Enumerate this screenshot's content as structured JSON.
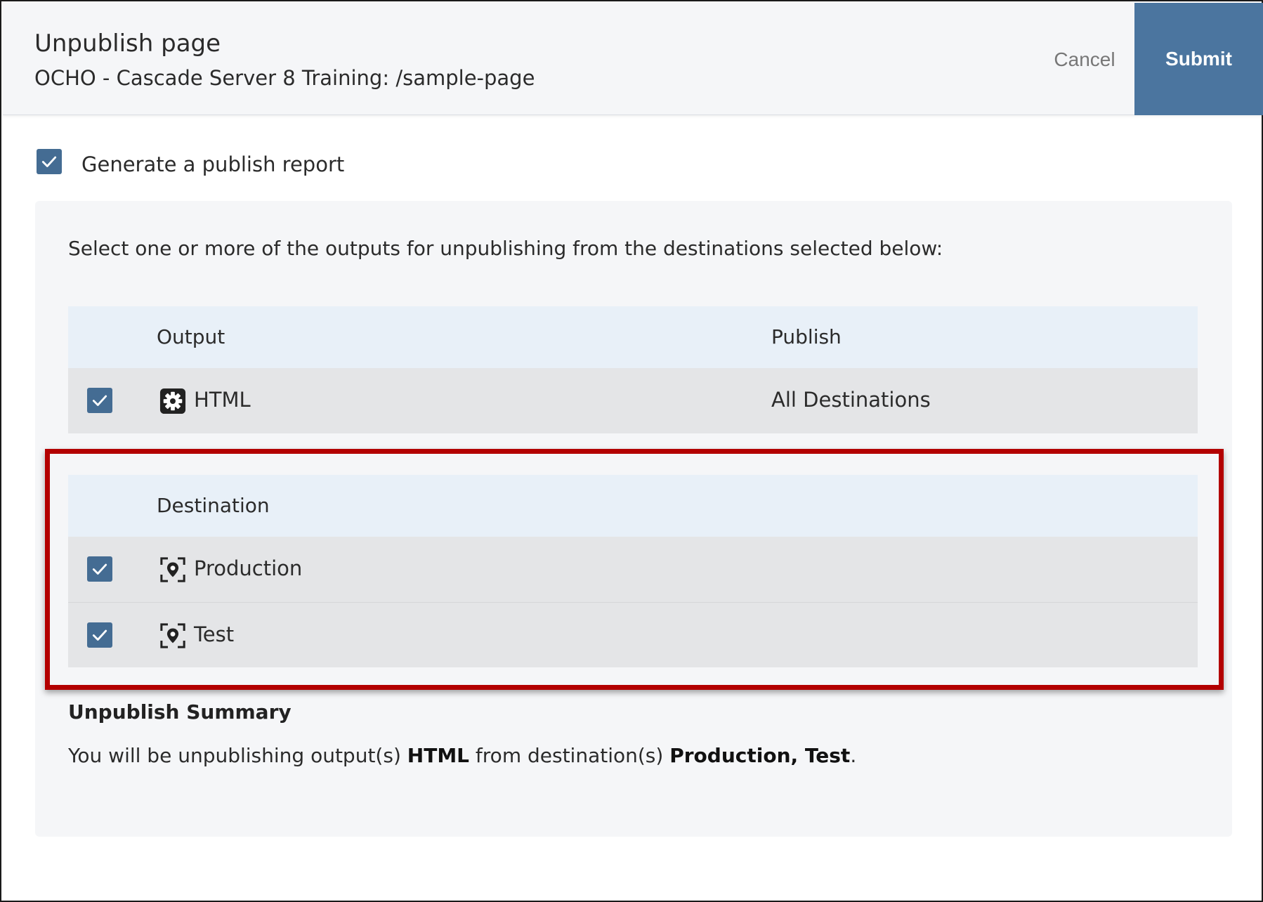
{
  "header": {
    "title": "Unpublish page",
    "subtitle": "OCHO - Cascade Server 8 Training: /sample-page",
    "cancel_label": "Cancel",
    "submit_label": "Submit"
  },
  "report": {
    "label": "Generate a publish report",
    "checked": true
  },
  "instructions": "Select one or more of the outputs for unpublishing from the destinations selected below:",
  "outputs_table": {
    "columns": [
      "Output",
      "Publish"
    ],
    "rows": [
      {
        "name": "HTML",
        "icon": "gear-icon",
        "publish": "All Destinations",
        "checked": true
      }
    ]
  },
  "destinations_table": {
    "columns": [
      "Destination"
    ],
    "rows": [
      {
        "name": "Production",
        "icon": "destination-pin-icon",
        "checked": true
      },
      {
        "name": "Test",
        "icon": "destination-pin-icon",
        "checked": true
      }
    ]
  },
  "summary": {
    "title": "Unpublish Summary",
    "prefix": "You will be unpublishing output(s) ",
    "outputs": "HTML",
    "middle": " from destination(s) ",
    "destinations": "Production, Test",
    "suffix": "."
  },
  "colors": {
    "accent": "#4b759f",
    "checkbox": "#446c93",
    "highlight": "#b30000"
  }
}
